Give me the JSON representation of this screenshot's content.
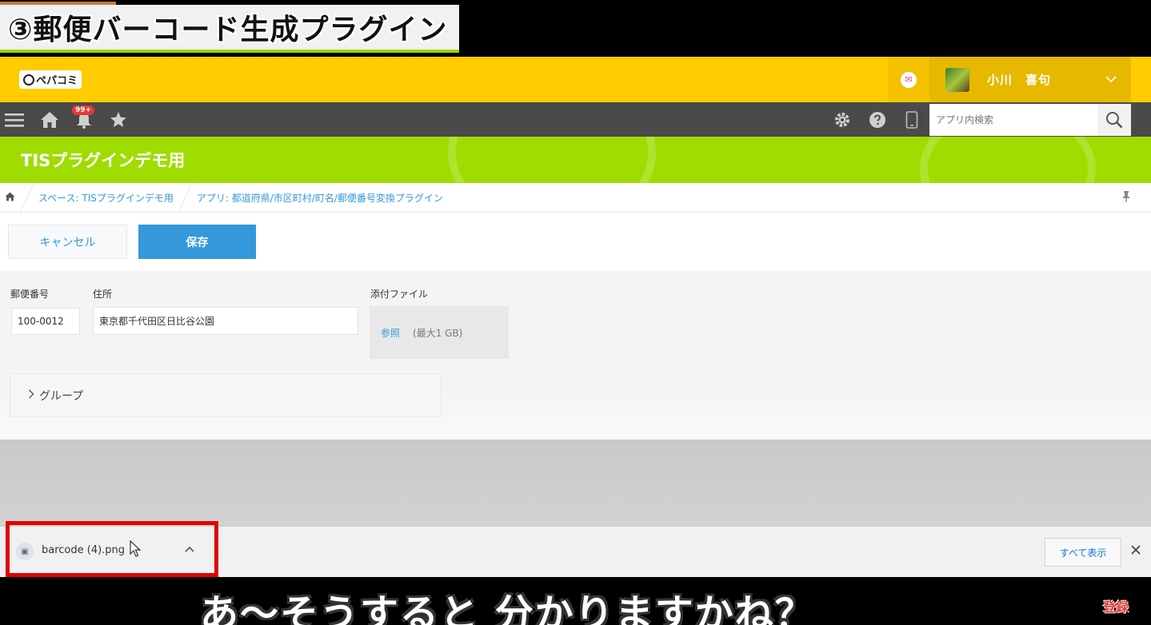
{
  "video": {
    "title": "③郵便バーコード生成プラグイン",
    "subtitle": "あ〜そうすると 分かりますかね？",
    "subscribe": "登録"
  },
  "header": {
    "logo_text": "ペパコミ",
    "user_name": "小川　喜句"
  },
  "toolbar": {
    "notification_count": "99+",
    "search_placeholder": "アプリ内検索"
  },
  "app": {
    "title": "TISプラグインデモ用"
  },
  "breadcrumb": {
    "space": "スペース: TISプラグインデモ用",
    "app": "アプリ: 都道府県/市区町村/町名/郵便番号変換プラグイン"
  },
  "actions": {
    "cancel_label": "キャンセル",
    "save_label": "保存"
  },
  "form": {
    "postal_label": "郵便番号",
    "postal_value": "100-0012",
    "address_label": "住所",
    "address_value": "東京都千代田区日比谷公園",
    "attachment_label": "添付ファイル",
    "browse_label": "参照",
    "max_size_note": "(最大1 GB)",
    "group_label": "グループ"
  },
  "downloads": {
    "file_name": "barcode (4).png",
    "show_all_label": "すべて表示"
  },
  "colors": {
    "header_yellow": "#ffcc00",
    "banner_green": "#9fdc00",
    "accent_blue": "#3498db",
    "highlight_red": "#e00000"
  }
}
